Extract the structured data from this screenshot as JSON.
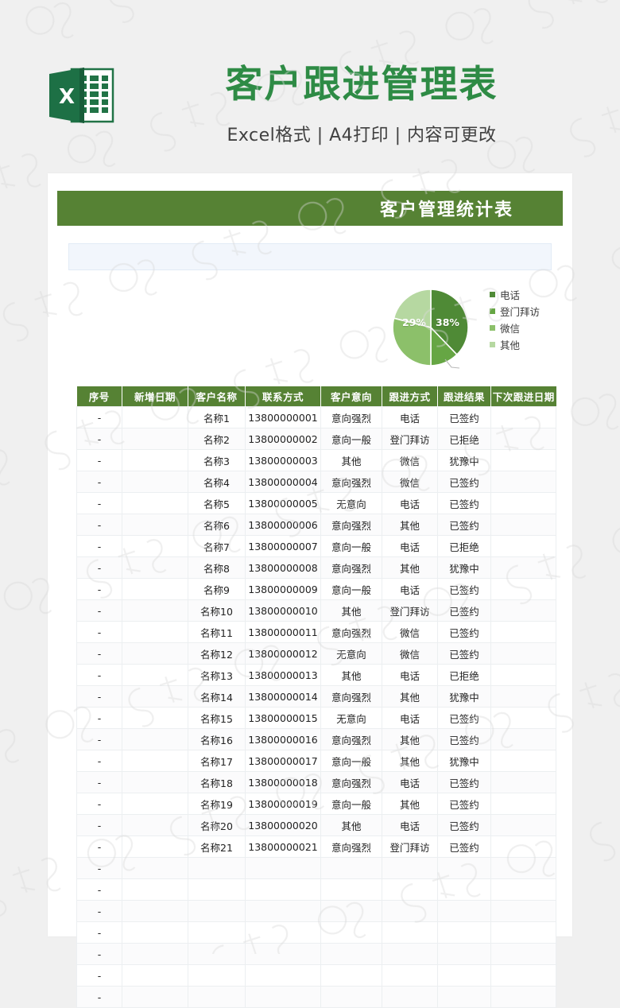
{
  "promo": {
    "logo_icon": "excel-file-icon",
    "title": "客户跟进管理表",
    "subtitle": "Excel格式 | A4打印 | 内容可更改",
    "title_color": "#2e8b45"
  },
  "sheet": {
    "banner_title": "客户管理统计表",
    "banner_color": "#568234",
    "blue_strip_color": "#f2f6fc"
  },
  "chart_data": {
    "type": "pie",
    "title": "",
    "legend_position": "right",
    "labels": [
      "电话",
      "登门拜访",
      "微信",
      "其他"
    ],
    "values": [
      38,
      12,
      21,
      29
    ],
    "display_labels": [
      "38%",
      "",
      "",
      "29%"
    ],
    "colors": [
      "#4f8a36",
      "#66a644",
      "#8cc06a",
      "#b6d8a1"
    ],
    "legend": [
      {
        "label": "电话",
        "color": "#4f8a36"
      },
      {
        "label": "登门拜访",
        "color": "#66a644"
      },
      {
        "label": "微信",
        "color": "#8cc06a"
      },
      {
        "label": "其他",
        "color": "#b6d8a1"
      }
    ]
  },
  "table": {
    "columns": [
      "序号",
      "新增日期",
      "客户名称",
      "联系方式",
      "客户意向",
      "跟进方式",
      "跟进结果",
      "下次跟进日期"
    ],
    "rows": [
      [
        "-",
        "",
        "名称1",
        "13800000001",
        "意向强烈",
        "电话",
        "已签约",
        ""
      ],
      [
        "-",
        "",
        "名称2",
        "13800000002",
        "意向一般",
        "登门拜访",
        "已拒绝",
        ""
      ],
      [
        "-",
        "",
        "名称3",
        "13800000003",
        "其他",
        "微信",
        "犹豫中",
        ""
      ],
      [
        "-",
        "",
        "名称4",
        "13800000004",
        "意向强烈",
        "微信",
        "已签约",
        ""
      ],
      [
        "-",
        "",
        "名称5",
        "13800000005",
        "无意向",
        "电话",
        "已签约",
        ""
      ],
      [
        "-",
        "",
        "名称6",
        "13800000006",
        "意向强烈",
        "其他",
        "已签约",
        ""
      ],
      [
        "-",
        "",
        "名称7",
        "13800000007",
        "意向一般",
        "电话",
        "已拒绝",
        ""
      ],
      [
        "-",
        "",
        "名称8",
        "13800000008",
        "意向强烈",
        "其他",
        "犹豫中",
        ""
      ],
      [
        "-",
        "",
        "名称9",
        "13800000009",
        "意向一般",
        "电话",
        "已签约",
        ""
      ],
      [
        "-",
        "",
        "名称10",
        "13800000010",
        "其他",
        "登门拜访",
        "已签约",
        ""
      ],
      [
        "-",
        "",
        "名称11",
        "13800000011",
        "意向强烈",
        "微信",
        "已签约",
        ""
      ],
      [
        "-",
        "",
        "名称12",
        "13800000012",
        "无意向",
        "微信",
        "已签约",
        ""
      ],
      [
        "-",
        "",
        "名称13",
        "13800000013",
        "其他",
        "电话",
        "已拒绝",
        ""
      ],
      [
        "-",
        "",
        "名称14",
        "13800000014",
        "意向强烈",
        "其他",
        "犹豫中",
        ""
      ],
      [
        "-",
        "",
        "名称15",
        "13800000015",
        "无意向",
        "电话",
        "已签约",
        ""
      ],
      [
        "-",
        "",
        "名称16",
        "13800000016",
        "意向强烈",
        "其他",
        "已签约",
        ""
      ],
      [
        "-",
        "",
        "名称17",
        "13800000017",
        "意向一般",
        "其他",
        "犹豫中",
        ""
      ],
      [
        "-",
        "",
        "名称18",
        "13800000018",
        "意向强烈",
        "电话",
        "已签约",
        ""
      ],
      [
        "-",
        "",
        "名称19",
        "13800000019",
        "意向一般",
        "其他",
        "已签约",
        ""
      ],
      [
        "-",
        "",
        "名称20",
        "13800000020",
        "其他",
        "电话",
        "已签约",
        ""
      ],
      [
        "-",
        "",
        "名称21",
        "13800000021",
        "意向强烈",
        "登门拜访",
        "已签约",
        ""
      ],
      [
        "-",
        "",
        "",
        "",
        "",
        "",
        "",
        ""
      ],
      [
        "-",
        "",
        "",
        "",
        "",
        "",
        "",
        ""
      ],
      [
        "-",
        "",
        "",
        "",
        "",
        "",
        "",
        ""
      ],
      [
        "-",
        "",
        "",
        "",
        "",
        "",
        "",
        ""
      ],
      [
        "-",
        "",
        "",
        "",
        "",
        "",
        "",
        ""
      ],
      [
        "-",
        "",
        "",
        "",
        "",
        "",
        "",
        ""
      ],
      [
        "-",
        "",
        "",
        "",
        "",
        "",
        "",
        ""
      ]
    ]
  }
}
